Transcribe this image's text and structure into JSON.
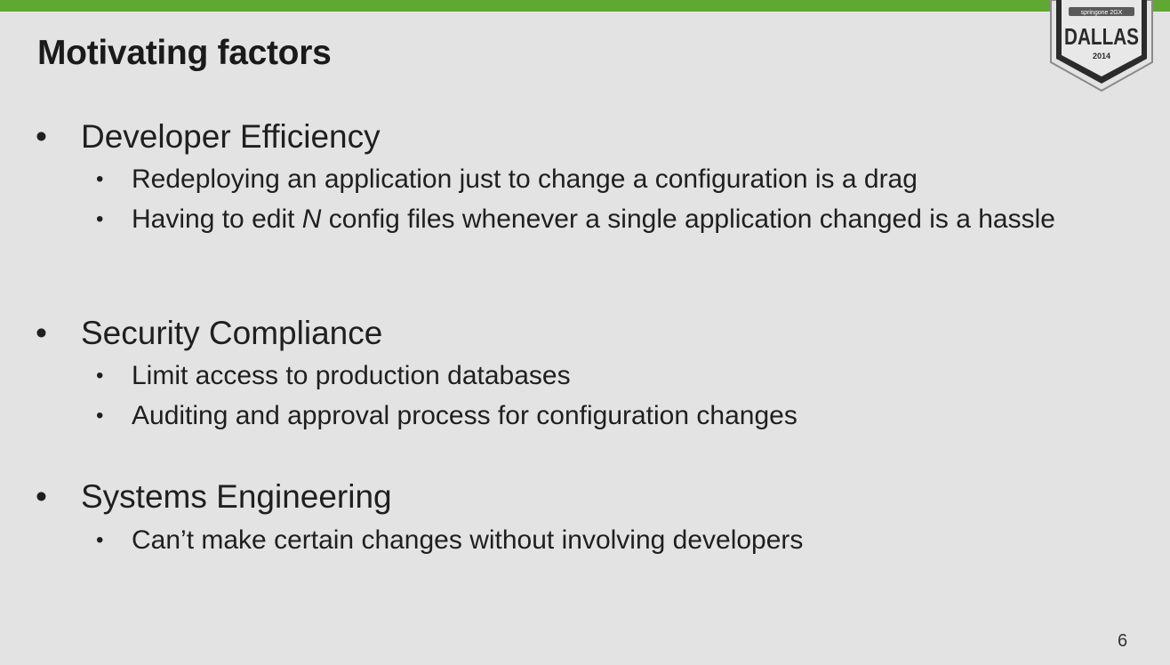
{
  "slide": {
    "title": "Motivating factors",
    "page_number": "6",
    "badge": {
      "top_text": "springone 2GX",
      "city": "DALLAS",
      "year": "2014"
    },
    "bullets": [
      {
        "text": "Developer Efficiency",
        "sub": [
          "Redeploying an application just to change a configuration is a drag",
          "Having to edit N config files whenever a single application changed is a hassle"
        ]
      },
      {
        "text": "Security Compliance",
        "sub": [
          "Limit access to production databases",
          "Auditing and approval process for configuration changes"
        ]
      },
      {
        "text": "Systems Engineering",
        "sub": [
          "Can’t make certain changes without involving developers"
        ]
      }
    ],
    "colors": {
      "background": "#e4e3e4",
      "accent_bar": "#5fa832",
      "text": "#1f1f1f",
      "badge": "#2b2b2b"
    }
  }
}
